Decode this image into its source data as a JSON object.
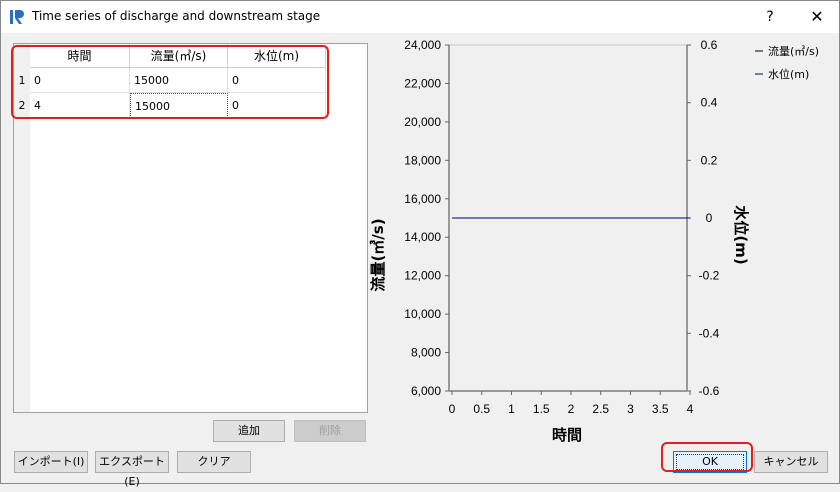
{
  "window": {
    "title": "Time series of discharge and downstream stage",
    "help": "?",
    "close": "✕"
  },
  "table": {
    "columns": [
      "時間",
      "流量(㎥/s)",
      "水位(m)"
    ],
    "rows": [
      {
        "num": "1",
        "cells": [
          "0",
          "15000",
          "0"
        ]
      },
      {
        "num": "2",
        "cells": [
          "4",
          "15000",
          "0"
        ]
      }
    ]
  },
  "buttons": {
    "add": "追加",
    "delete": "削除",
    "import": "インポート(I)",
    "export": "エクスポート(E)",
    "clear": "クリア",
    "ok": "OK",
    "cancel": "キャンセル"
  },
  "colors": {
    "highlight": "#e02020",
    "series_line": "#000080"
  },
  "chart_data": {
    "type": "line",
    "xlabel": "時間",
    "ylabel_left": "流量(㎥/s)",
    "ylabel_right": "水位(m)",
    "x_ticks": [
      "0",
      "0.5",
      "1",
      "1.5",
      "2",
      "2.5",
      "3",
      "3.5",
      "4"
    ],
    "y_left_ticks": [
      "24,000",
      "22,000",
      "20,000",
      "18,000",
      "16,000",
      "14,000",
      "12,000",
      "10,000",
      "8,000",
      "6,000"
    ],
    "y_right_ticks": [
      "0.6",
      "0.4",
      "0.2",
      "0",
      "-0.2",
      "-0.4",
      "-0.6"
    ],
    "xlim": [
      0,
      4
    ],
    "ylim_left": [
      6000,
      24000
    ],
    "ylim_right": [
      -0.6,
      0.6
    ],
    "series": [
      {
        "name": "流量(㎥/s)",
        "axis": "left",
        "x": [
          0,
          4
        ],
        "y": [
          15000,
          15000
        ]
      },
      {
        "name": "水位(m)",
        "axis": "right",
        "x": [
          0,
          4
        ],
        "y": [
          0,
          0
        ]
      }
    ],
    "legend_position": "top-right",
    "grid": false
  }
}
